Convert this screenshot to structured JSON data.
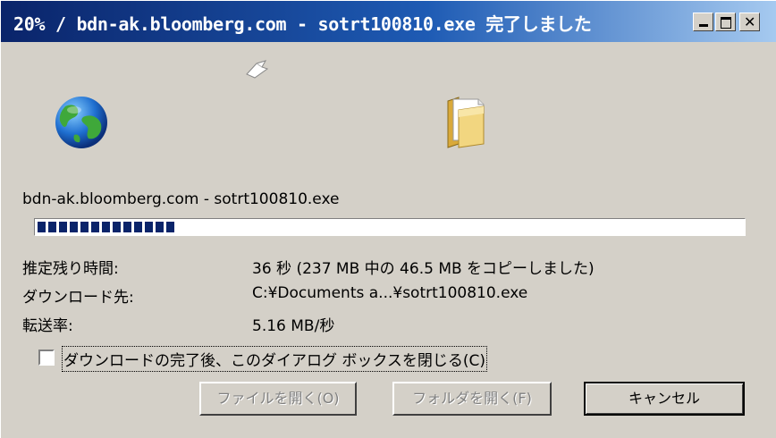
{
  "window": {
    "title": "20% / bdn-ak.bloomberg.com - sotrt100810.exe 完了しました",
    "controls": [
      "minimize-icon",
      "maximize-icon",
      "close-icon"
    ]
  },
  "icons": {
    "animation": "flying-paper-icon",
    "source": "globe-icon",
    "destination": "folder-icon"
  },
  "download": {
    "info": "bdn-ak.bloomberg.com - sotrt100810.exe",
    "progress_fraction": 0.2,
    "rows": [
      {
        "label": "推定残り時間:",
        "value": "36 秒 (237 MB 中の 46.5 MB をコピーしました)"
      },
      {
        "label": "ダウンロード先:",
        "value": "C:¥Documents a...¥sotrt100810.exe"
      },
      {
        "label": "転送率:",
        "value": "5.16 MB/秒"
      }
    ]
  },
  "options": {
    "close_on_complete_label": "ダウンロードの完了後、このダイアログ ボックスを閉じる(C)",
    "close_on_complete_checked": false
  },
  "buttons": {
    "open_file": "ファイルを開く(O)",
    "open_folder": "フォルダを開く(F)",
    "cancel": "キャンセル"
  },
  "colors": {
    "titlebar_start": "#0a246a",
    "titlebar_end": "#a6caf0",
    "progress": "#0a246a",
    "face": "#d4d0c8"
  }
}
